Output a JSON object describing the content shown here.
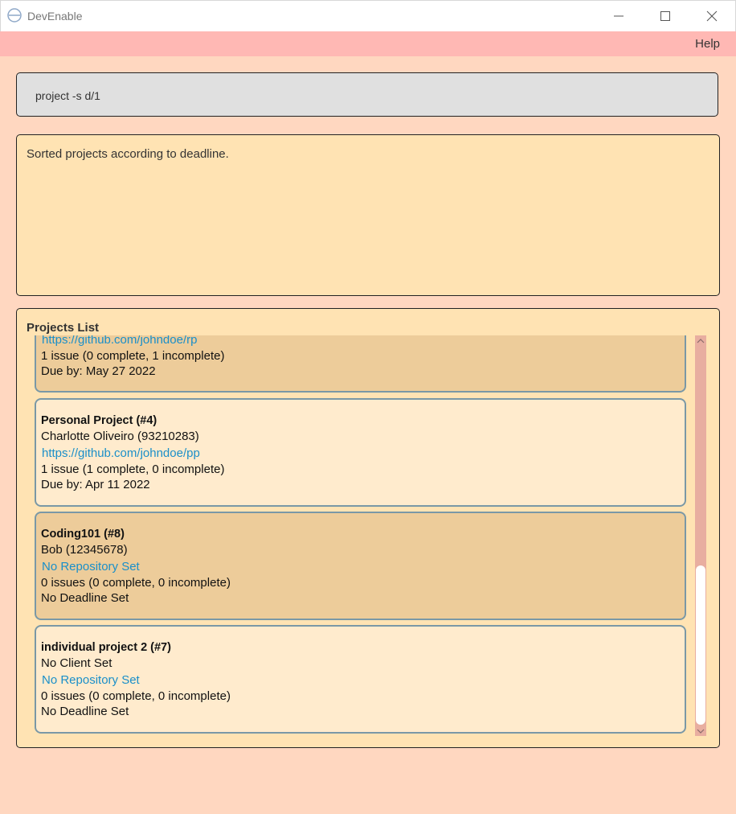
{
  "window": {
    "title": "DevEnable"
  },
  "menu": {
    "help_label": "Help"
  },
  "command": {
    "value": "project -s d/1"
  },
  "result": {
    "message": "Sorted projects according to deadline."
  },
  "projects": {
    "title": "Projects List",
    "items": [
      {
        "repo": "https://github.com/johndoe/rp",
        "issues": "1 issue (0 complete, 1 incomplete)",
        "deadline": "Due by: May 27 2022"
      },
      {
        "name": "Personal Project (#4)",
        "client": "Charlotte Oliveiro (93210283)",
        "repo": "https://github.com/johndoe/pp",
        "issues": "1 issue (1 complete, 0 incomplete)",
        "deadline": "Due by: Apr 11 2022"
      },
      {
        "name": "Coding101 (#8)",
        "client": "Bob (12345678)",
        "repo": "No Repository Set",
        "issues": "0 issues (0 complete, 0 incomplete)",
        "deadline": "No Deadline Set"
      },
      {
        "name": "individual project 2 (#7)",
        "client": "No Client Set",
        "repo": "No Repository Set",
        "issues": "0 issues (0 complete, 0 incomplete)",
        "deadline": "No Deadline Set"
      }
    ]
  },
  "colors": {
    "background": "#ffd7c0",
    "menubar": "#ffb8b4",
    "panel": "#ffe3b3",
    "card_odd": "#edcc9a",
    "card_even": "#ffebcd",
    "link": "#1a8fc9"
  },
  "icons": [
    "app-icon",
    "minimize-icon",
    "maximize-icon",
    "close-icon",
    "scroll-up-icon",
    "scroll-down-icon"
  ]
}
